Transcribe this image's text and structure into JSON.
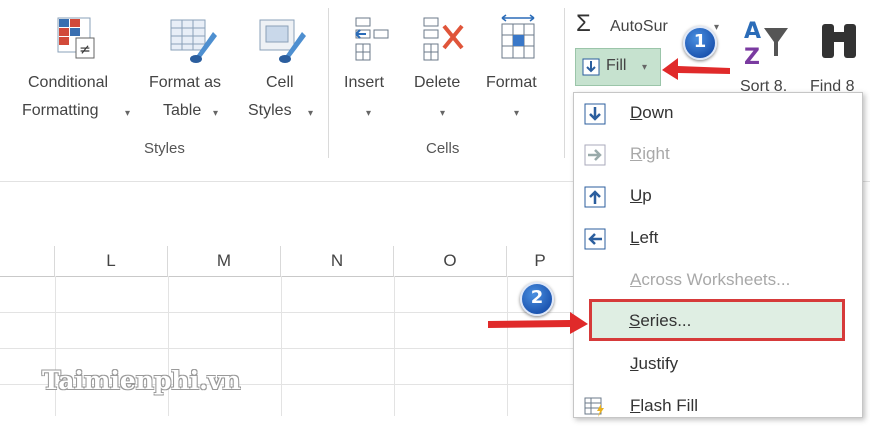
{
  "ribbon": {
    "styles_group": {
      "label": "Styles",
      "conditional_formatting": {
        "line1": "Conditional",
        "line2": "Formatting",
        "caret": "▾"
      },
      "format_as_table": {
        "line1": "Format as",
        "line2": "Table",
        "caret": "▾"
      },
      "cell_styles": {
        "line1": "Cell",
        "line2": "Styles",
        "caret": "▾"
      }
    },
    "cells_group": {
      "label": "Cells",
      "insert": {
        "label": "Insert",
        "caret": "▾"
      },
      "delete": {
        "label": "Delete",
        "caret": "▾"
      },
      "format": {
        "label": "Format",
        "caret": "▾"
      }
    },
    "editing_group": {
      "autosum": {
        "label": "AutoSur",
        "caret": "▾"
      },
      "fill": {
        "label": "Fill",
        "caret": "▾"
      },
      "sort_filter": {
        "label": "Sort 8."
      },
      "find_select": {
        "label": "Find 8"
      }
    }
  },
  "columns": [
    "L",
    "M",
    "N",
    "O",
    "P"
  ],
  "fill_menu": {
    "items": [
      {
        "key": "down",
        "accel": "D",
        "rest": "own",
        "enabled": true
      },
      {
        "key": "right",
        "accel": "R",
        "rest": "ight",
        "enabled": false
      },
      {
        "key": "up",
        "accel": "U",
        "rest": "p",
        "enabled": true
      },
      {
        "key": "left",
        "accel": "L",
        "rest": "eft",
        "enabled": true
      },
      {
        "key": "across",
        "accel": "A",
        "rest": "cross Worksheets...",
        "enabled": false
      },
      {
        "key": "series",
        "accel": "S",
        "rest": "eries...",
        "enabled": true
      },
      {
        "key": "justify",
        "accel": "J",
        "rest": "ustify",
        "enabled": true
      },
      {
        "key": "flash",
        "accel": "F",
        "rest": "lash Fill",
        "enabled": true
      }
    ]
  },
  "annotations": {
    "badge1": "1",
    "badge2": "2"
  },
  "colors": {
    "accent_green": "#217346",
    "highlight_red": "#d63a3a",
    "badge_blue": "#0b3f9e"
  },
  "watermark": "Taimienphi.vn"
}
